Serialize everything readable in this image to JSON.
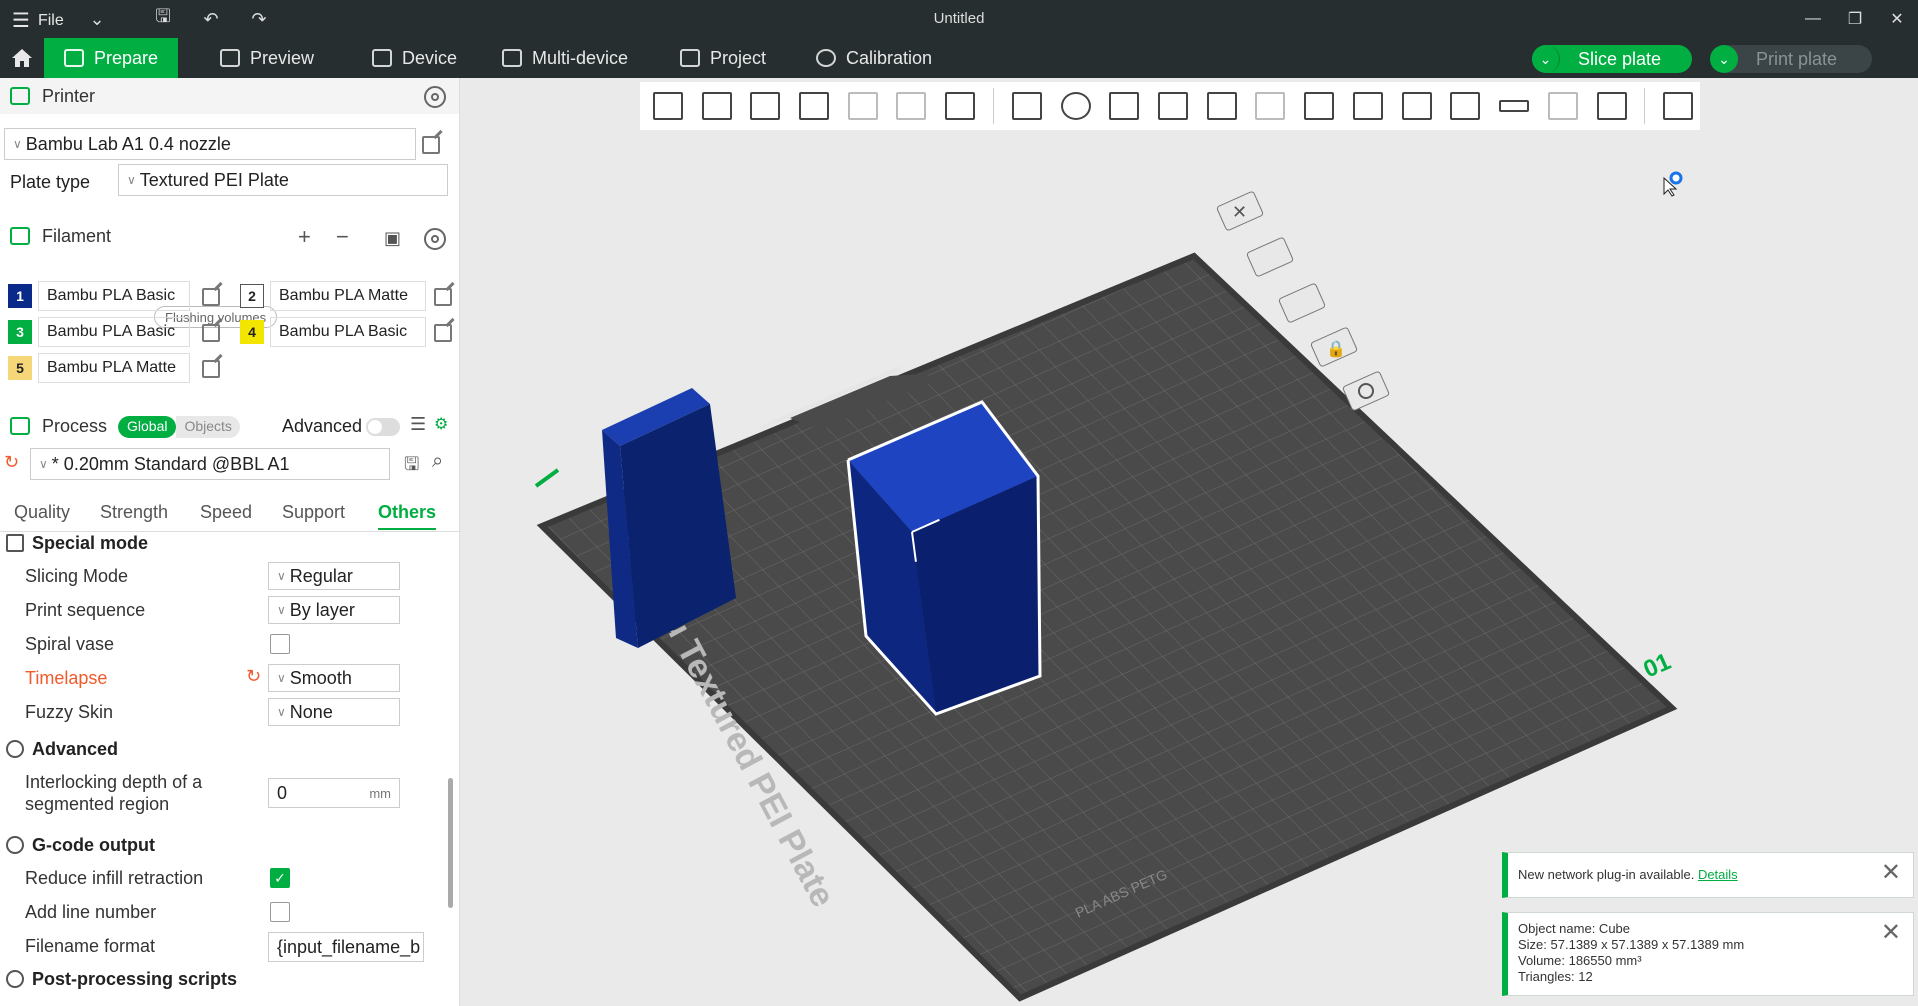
{
  "app": {
    "window_title": "Untitled",
    "menu_label": "File"
  },
  "nav": {
    "tabs": [
      {
        "label": "Prepare",
        "icon": "cube-icon"
      },
      {
        "label": "Preview",
        "icon": "layers-icon"
      },
      {
        "label": "Device",
        "icon": "device-icon"
      },
      {
        "label": "Multi-device",
        "icon": "multi-device-icon"
      },
      {
        "label": "Project",
        "icon": "project-icon"
      },
      {
        "label": "Calibration",
        "icon": "calibration-icon"
      }
    ],
    "slice_label": "Slice plate",
    "print_label": "Print plate"
  },
  "printer": {
    "section_title": "Printer",
    "printer_name": "Bambu Lab A1 0.4 nozzle",
    "plate_type_label": "Plate type",
    "plate_type_value": "Textured PEI Plate"
  },
  "filament": {
    "section_title": "Filament",
    "flushing_label": "Flushing volumes",
    "slots": [
      {
        "num": "1",
        "name": "Bambu PLA Basic",
        "color": "#0a2a8a",
        "text_color": "#ffffff"
      },
      {
        "num": "2",
        "name": "Bambu PLA Matte",
        "color": "#ffffff",
        "text_color": "#222222"
      },
      {
        "num": "3",
        "name": "Bambu PLA Basic",
        "color": "#00ae42",
        "text_color": "#ffffff"
      },
      {
        "num": "4",
        "name": "Bambu PLA Basic",
        "color": "#f2e600",
        "text_color": "#222222"
      },
      {
        "num": "5",
        "name": "Bambu PLA Matte",
        "color": "#f5d77a",
        "text_color": "#222222"
      }
    ]
  },
  "process": {
    "section_title": "Process",
    "global_label": "Global",
    "objects_label": "Objects",
    "advanced_label": "Advanced",
    "preset": "* 0.20mm Standard @BBL A1",
    "tabs": [
      "Quality",
      "Strength",
      "Speed",
      "Support",
      "Others"
    ],
    "active_tab": "Others"
  },
  "options": {
    "special_mode": {
      "title": "Special mode",
      "slicing_mode_label": "Slicing Mode",
      "slicing_mode_value": "Regular",
      "print_sequence_label": "Print sequence",
      "print_sequence_value": "By layer",
      "spiral_vase_label": "Spiral vase",
      "timelapse_label": "Timelapse",
      "timelapse_value": "Smooth",
      "fuzzy_skin_label": "Fuzzy Skin",
      "fuzzy_skin_value": "None"
    },
    "advanced": {
      "title": "Advanced",
      "interlocking_label_1": "Interlocking depth of a",
      "interlocking_label_2": "segmented region",
      "interlocking_value": "0",
      "interlocking_unit": "mm"
    },
    "gcode_output": {
      "title": "G-code output",
      "reduce_infill_label": "Reduce infill retraction",
      "reduce_infill_checked": true,
      "add_line_number_label": "Add line number",
      "filename_format_label": "Filename format",
      "filename_format_value": "{input_filename_b"
    },
    "post_processing": {
      "title": "Post-processing scripts"
    }
  },
  "scene": {
    "plate_text": "Bambu Textured PEI Plate",
    "plate_number": "01",
    "materials_text": "PLA ABS PETG",
    "object_color": "#0d2680"
  },
  "notifications": {
    "plugin_text": "New network plug-in available.",
    "plugin_link": "Details",
    "object_name": "Object name: Cube",
    "object_size": "Size: 57.1389 x 57.1389 x 57.1389 mm",
    "object_volume": "Volume: 186550 mm³",
    "object_triangles": "Triangles: 12"
  },
  "colors": {
    "accent": "#00ae42",
    "dark_bar": "#262e30",
    "modified": "#f05b2c"
  }
}
